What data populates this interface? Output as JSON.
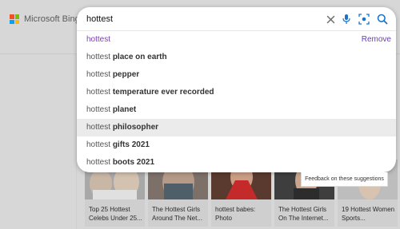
{
  "brand": {
    "name": "Microsoft Bing",
    "logo_colors": [
      "#f25022",
      "#7fba00",
      "#00a4ef",
      "#ffb900"
    ]
  },
  "search": {
    "query": "hottest"
  },
  "icons": {
    "clear": "close-icon",
    "voice": "microphone-icon",
    "visual_search": "camera-scan-icon",
    "search": "search-icon"
  },
  "accent_color": "#1a73c8",
  "suggestions": [
    {
      "prefix": "hottest",
      "suffix": "",
      "visited": true,
      "action": "Remove"
    },
    {
      "prefix": "hottest",
      "suffix": "place on earth"
    },
    {
      "prefix": "hottest",
      "suffix": "pepper"
    },
    {
      "prefix": "hottest",
      "suffix": "temperature ever recorded"
    },
    {
      "prefix": "hottest",
      "suffix": "planet"
    },
    {
      "prefix": "hottest",
      "suffix": "philosopher",
      "highlighted": true
    },
    {
      "prefix": "hottest",
      "suffix": "gifts 2021"
    },
    {
      "prefix": "hottest",
      "suffix": "boots 2021"
    }
  ],
  "feedback": {
    "label": "Feedback on these suggestions"
  },
  "image_results": [
    {
      "caption": "Top 25 Hottest Celebs Under 25..."
    },
    {
      "caption": "The Hottest Girls Around The Net..."
    },
    {
      "caption": "hottest babes: Photo"
    },
    {
      "caption": "The Hottest Girls On The Internet..."
    },
    {
      "caption": "19 Hottest Women Sports..."
    }
  ]
}
